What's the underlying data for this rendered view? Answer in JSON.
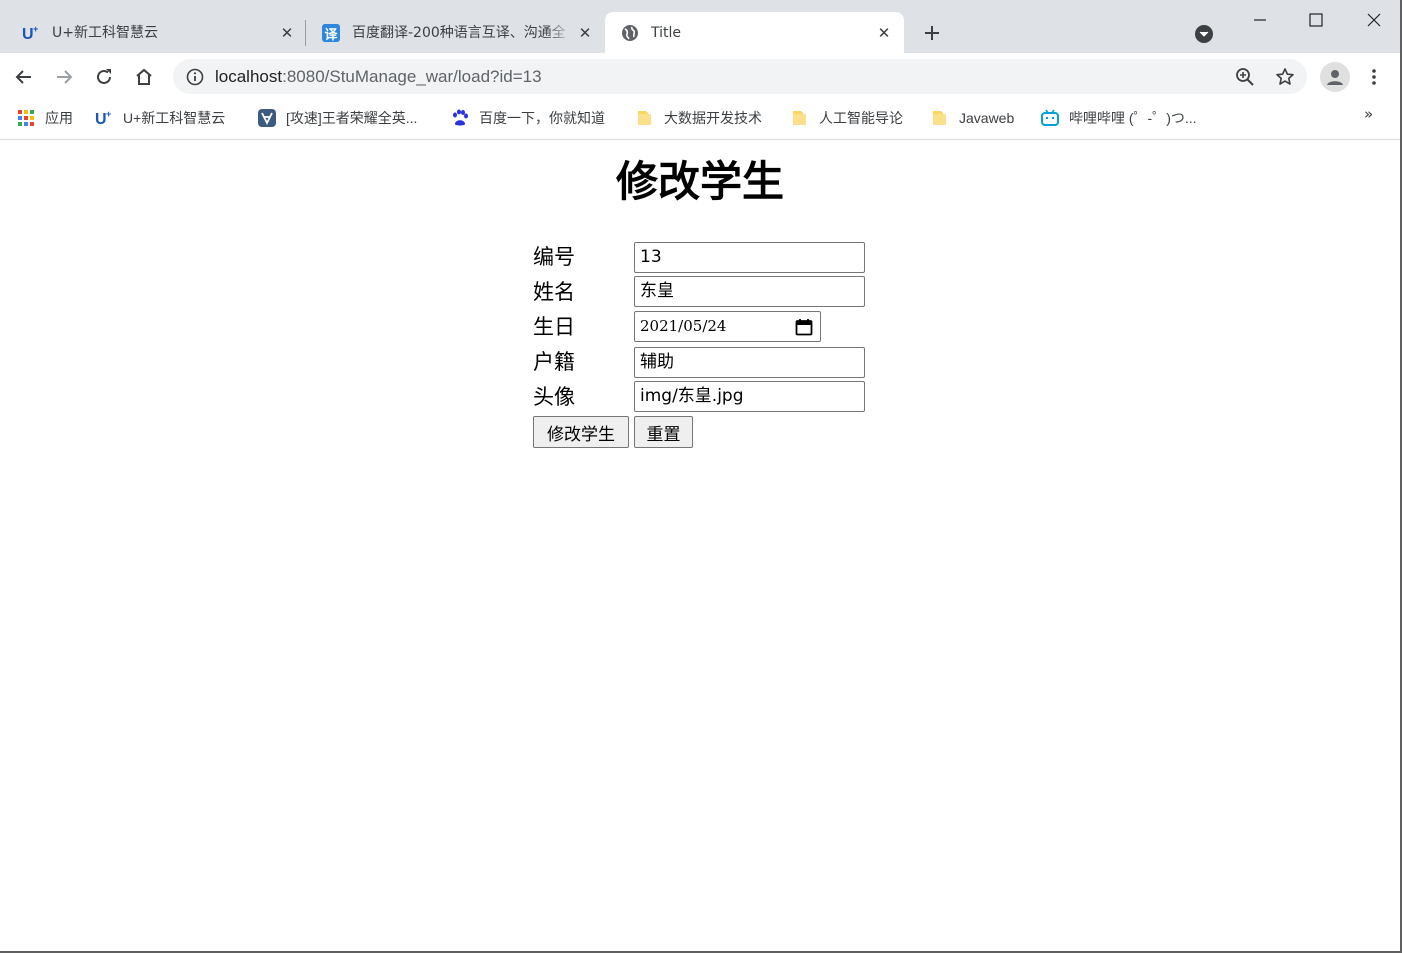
{
  "tabs": [
    {
      "title": "U+新工科智慧云",
      "favicon": "u-plus-logo-icon"
    },
    {
      "title": "百度翻译-200种语言互译、沟通全",
      "favicon": "baidu-translate-icon",
      "favicon_text": "译"
    },
    {
      "title": "Title",
      "favicon": "globe-icon",
      "active": true
    }
  ],
  "omnibox": {
    "url_host": "localhost",
    "url_rest": ":8080/StuManage_war/load?id=13"
  },
  "bookmarks": [
    {
      "label": "应用",
      "icon": "apps-grid-icon"
    },
    {
      "label": "U+新工科智慧云",
      "icon": "u-plus-logo-icon"
    },
    {
      "label": "[攻速]王者荣耀全英...",
      "icon": "game-site-icon"
    },
    {
      "label": "百度一下，你就知道",
      "icon": "baidu-paw-icon"
    },
    {
      "label": "大数据开发技术",
      "icon": "folder-icon"
    },
    {
      "label": "人工智能导论",
      "icon": "folder-icon"
    },
    {
      "label": "Javaweb",
      "icon": "folder-icon"
    },
    {
      "label": "哔哩哔哩 (゜-゜)つ...",
      "icon": "bilibili-icon"
    }
  ],
  "bookmarks_more": "»",
  "page": {
    "title": "修改学生",
    "fields": [
      {
        "label": "编号",
        "value": "13",
        "type": "text"
      },
      {
        "label": "姓名",
        "value": "东皇",
        "type": "text"
      },
      {
        "label": "生日",
        "value": "2021/05/24",
        "type": "date"
      },
      {
        "label": "户籍",
        "value": "辅助",
        "type": "text"
      },
      {
        "label": "头像",
        "value": "img/东皇.jpg",
        "type": "text"
      }
    ],
    "submit_label": "修改学生",
    "reset_label": "重置"
  },
  "colors": {
    "tabstrip_bg": "#dee1e6",
    "omnibox_bg": "#f1f3f4",
    "folder_yellow": "#fcd663",
    "bilibili_blue": "#00a1d6",
    "baidu_blue": "#2932e1",
    "translate_blue": "#2e86de"
  }
}
